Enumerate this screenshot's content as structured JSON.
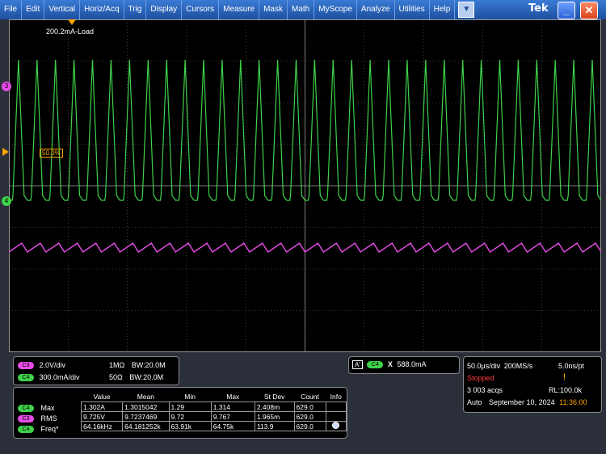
{
  "menu": {
    "items": [
      "File",
      "Edit",
      "Vertical",
      "Horiz/Acq",
      "Trig",
      "Display",
      "Cursors",
      "Measure",
      "Mask",
      "Math",
      "MyScope",
      "Analyze",
      "Utilities",
      "Help"
    ],
    "dropdown_icon": "chevron-down-icon",
    "brand": "Tek",
    "minimize": "_",
    "close": "✕"
  },
  "screen": {
    "annotation": "200.2mA-Load",
    "ch3_marker": "3",
    "ch4_marker": "4",
    "trigger_level": "50.0%"
  },
  "channels": [
    {
      "pill": "C3",
      "scale": "2.0V/div",
      "impedance": "1MΩ",
      "bw_label": "BW",
      "bw": ":20.0M"
    },
    {
      "pill": "C4",
      "scale": "300.0mA/div",
      "impedance": "50Ω",
      "bw_label": "BW",
      "bw": ":20.0M"
    }
  ],
  "trigger": {
    "source": "A'",
    "pill": "C4",
    "symbol": "X",
    "level": "588.0mA"
  },
  "measurements": {
    "headers": [
      "Value",
      "Mean",
      "Min",
      "Max",
      "St Dev",
      "Count",
      "Info"
    ],
    "rows": [
      {
        "pill": "C4",
        "label": "Max",
        "values": [
          "1.302A",
          "1.3015042",
          "1.29",
          "1.314",
          "2.408m",
          "629.0",
          ""
        ]
      },
      {
        "pill": "C3",
        "label": "RMS",
        "values": [
          "9.725V",
          "9.7237469",
          "9.72",
          "9.767",
          "1.965m",
          "629.0",
          ""
        ]
      },
      {
        "pill": "C4",
        "label": "Freq*",
        "values": [
          "64.16kHz",
          "64.181252k",
          "63.91k",
          "64.75k",
          "113.9",
          "629.0",
          ""
        ]
      }
    ]
  },
  "acquisition": {
    "timebase": "50.0µs/div",
    "sample_rate": "200MS/s",
    "resolution": "5.0ns/pt",
    "state": "Stopped",
    "acqs": "3 003 acqs",
    "record_length": "RL:100.0k",
    "mode": "Auto",
    "date": "September 10, 2024",
    "time": "11:36:00"
  },
  "colors": {
    "ch3": "#e64ce6",
    "ch4": "#3fd14a",
    "stopped": "#ff3b3b",
    "time": "#ffa500",
    "grid": "#6a6a6a"
  },
  "waveform_data": {
    "ch4_periods_shown": 32,
    "ch3_periods_shown": 32
  }
}
